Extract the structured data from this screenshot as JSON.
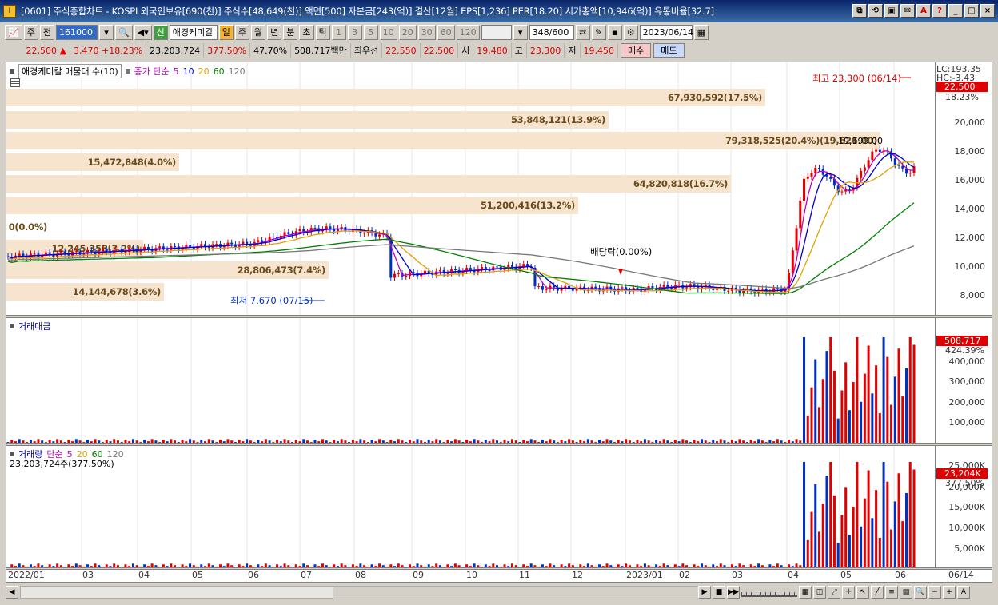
{
  "window": {
    "title": "[0601] 주식종합차트 - KOSPI 외국인보유[690(천)] 주식수[48,649(천)] 액면[500] 자본금[243(억)] 결산[12월] EPS[1,236] PER[18.20] 시가총액[10,946(억)] 유통비율[32.7]",
    "buttons": [
      "⧉",
      "⟲",
      "▣",
      "✉",
      "A",
      "?",
      "_",
      "□",
      "×"
    ]
  },
  "toolbar": {
    "period_mode": "주",
    "prev_label": "전",
    "code": "161000",
    "stock_name": "애경케미칼",
    "credit_label": "신",
    "periods": [
      "일",
      "주",
      "월",
      "년",
      "분",
      "초",
      "틱"
    ],
    "selected_period": "일",
    "intervals": [
      "1",
      "3",
      "5",
      "10",
      "20",
      "30",
      "60",
      "120"
    ],
    "count": "348",
    "count_max": "/600",
    "date": "2023/06/14"
  },
  "quote": {
    "price": "22,500",
    "direction": "▲",
    "change": "3,470",
    "change_rate": "+18.23%",
    "volume": "23,203,724",
    "volume_ratio": "377.50%",
    "turnover": "47.70%",
    "amount": "508,717백만",
    "best_label": "최우선",
    "best_ask": "22,550",
    "best_bid": "22,500",
    "open_label": "시",
    "open": "19,480",
    "high_label": "고",
    "high": "23,300",
    "low_label": "저",
    "low": "19,450",
    "buy_label": "매수",
    "sell_label": "매도"
  },
  "price_pane": {
    "stock_label": "애경케미칼 매물대 수(10)",
    "ma_label": "종가 단순",
    "ma_periods": [
      "5",
      "10",
      "20",
      "60",
      "120"
    ],
    "lc": "LC:193.35",
    "hc": "HC:-3.43",
    "current_tag": "22,500",
    "current_pct": "18.23%",
    "y_ticks": [
      "20,000",
      "18,000",
      "16,000",
      "14,000",
      "12,000",
      "10,000",
      "8,000"
    ],
    "high_note": "최고 23,300 (06/14)",
    "low_note": "최저 7,670 (07/15)",
    "dividend_note": "배당락(0.00%)",
    "volume_profile": [
      "67,930,592(17.5%)",
      "53,848,121(13.9%)",
      "79,318,525(20.4%)(19,626.00)",
      "15,472,848(4.0%)",
      "64,820,818(16.7%)",
      "51,200,416(13.2%)",
      "0(0.0%)",
      "12,245,358(3.2%)",
      "28,806,473(7.4%)",
      "14,144,678(3.6%)"
    ],
    "inline_price": "19,199.00"
  },
  "amount_pane": {
    "label": "거래대금",
    "tag": "508,717",
    "tag_pct": "424.39%",
    "y_ticks": [
      "400,000",
      "300,000",
      "200,000",
      "100,000"
    ]
  },
  "volume_pane": {
    "label": "거래량",
    "ma_label": "단순",
    "ma_periods": [
      "5",
      "20",
      "60",
      "120"
    ],
    "current": "23,203,724주(377.50%)",
    "tag": "23,204K",
    "tag_pct": "377.50%",
    "y_ticks": [
      "25,000K",
      "20,000K",
      "15,000K",
      "10,000K",
      "5,000K"
    ]
  },
  "x_axis": {
    "labels": [
      "2022/01",
      "03",
      "04",
      "05",
      "06",
      "07",
      "08",
      "09",
      "10",
      "11",
      "12",
      "2023/01",
      "02",
      "03",
      "04",
      "05",
      "06"
    ],
    "right_label": "06/14"
  },
  "colors": {
    "up": "#e00000",
    "down": "#0030c0",
    "profile": "#f6e4cf"
  }
}
